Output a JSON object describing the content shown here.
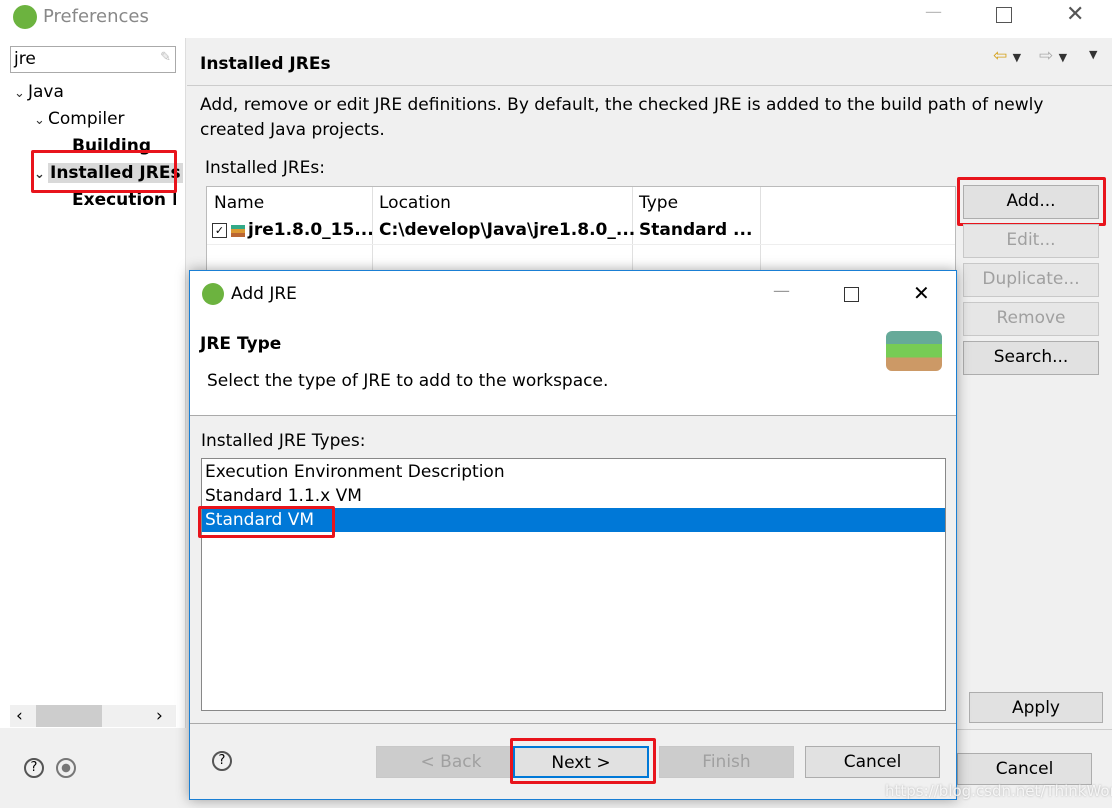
{
  "window": {
    "title": "Preferences",
    "icon": "spring-leaf-icon"
  },
  "filter": {
    "value": "jre"
  },
  "tree": [
    {
      "label": "Java",
      "expanded": true
    },
    {
      "label": "Compiler",
      "expanded": true
    },
    {
      "label": "Building"
    },
    {
      "label": "Installed JREs",
      "expanded": true,
      "selected": true
    },
    {
      "label": "Execution E"
    }
  ],
  "page": {
    "title": "Installed JREs",
    "description": "Add, remove or edit JRE definitions. By default, the checked JRE is added to the build path of newly created Java projects.",
    "table_label": "Installed JREs:",
    "columns": [
      "Name",
      "Location",
      "Type"
    ],
    "rows": [
      {
        "checked": true,
        "name": "jre1.8.0_15...",
        "location": "C:\\develop\\Java\\jre1.8.0_...",
        "type": "Standard ..."
      }
    ],
    "buttons": {
      "add": "Add...",
      "edit": "Edit...",
      "duplicate": "Duplicate...",
      "remove": "Remove",
      "search": "Search..."
    },
    "apply": "Apply",
    "cancel": "Cancel"
  },
  "dialog": {
    "title": "Add JRE",
    "heading": "JRE Type",
    "subtitle": "Select the type of JRE to add to the workspace.",
    "list_label": "Installed JRE Types:",
    "types": [
      "Execution Environment Description",
      "Standard 1.1.x VM",
      "Standard VM"
    ],
    "selected_index": 2,
    "buttons": {
      "back": "< Back",
      "next": "Next >",
      "finish": "Finish",
      "cancel": "Cancel"
    }
  },
  "watermark": "https://blog.csdn.net/ThinkWon",
  "colors": {
    "selection": "#0078d7",
    "highlight": "#e8141c"
  }
}
